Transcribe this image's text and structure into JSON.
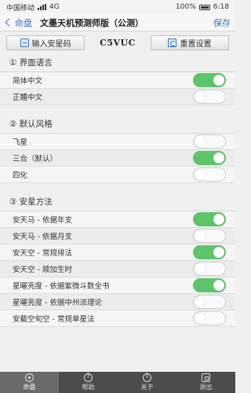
{
  "status": {
    "carrier": "中国移动",
    "network": "4G",
    "battery": "100%",
    "time": "6:18"
  },
  "nav": {
    "back_label": "命盘",
    "title": "文墨天机预测师版（公测）",
    "save_label": "保存"
  },
  "toolbar": {
    "input_code_label": "输入安星码",
    "code": "C5VUC",
    "reset_label": "重置设置"
  },
  "sections": [
    {
      "title": "① 界面语言",
      "rows": [
        {
          "label": "简体中文",
          "on": true
        },
        {
          "label": "正體中文",
          "on": false
        }
      ]
    },
    {
      "title": "② 默认风格",
      "rows": [
        {
          "label": "飞星",
          "on": false
        },
        {
          "label": "三合（默认）",
          "on": true
        },
        {
          "label": "四化",
          "on": false
        }
      ]
    },
    {
      "title": "③ 安星方法",
      "rows": [
        {
          "label": "安天马 - 依据年支",
          "on": true
        },
        {
          "label": "安天马 - 依据月支",
          "on": false
        },
        {
          "label": "安天空 - 常规排法",
          "on": true
        },
        {
          "label": "安天空 - 顺加生时",
          "on": false
        },
        {
          "label": "星曜亮度 - 依据紫微斗数全书",
          "on": true
        },
        {
          "label": "星曜亮度 - 依据中州派理论",
          "on": false
        },
        {
          "label": "安截空旬空 - 常规单星法",
          "on": false
        }
      ]
    }
  ],
  "tabs": [
    {
      "label": "命盘",
      "icon": "pan-icon",
      "active": true
    },
    {
      "label": "帮助",
      "icon": "help-icon",
      "active": false
    },
    {
      "label": "关于",
      "icon": "info-icon",
      "active": false
    },
    {
      "label": "退出",
      "icon": "exit-icon",
      "active": false
    }
  ],
  "colors": {
    "accent": "#3a72c8",
    "toggle_on": "#5ec46b",
    "tab_bar": "#4c4c4c"
  }
}
